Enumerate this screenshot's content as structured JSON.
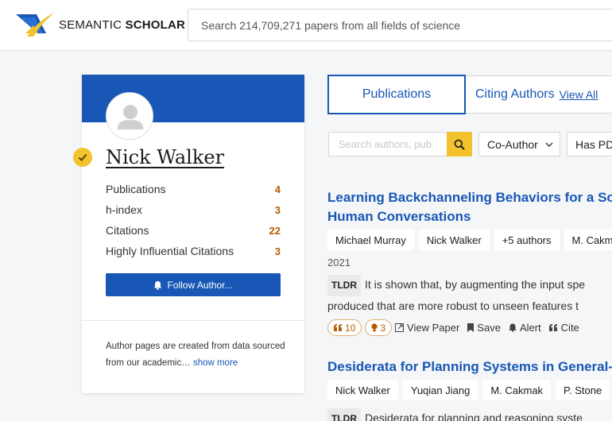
{
  "header": {
    "logo_text_light": "SEMANTIC",
    "logo_text_bold": "SCHOLAR",
    "search_placeholder": "Search 214,709,271 papers from all fields of science"
  },
  "author": {
    "name": "Nick Walker",
    "stats": [
      {
        "label": "Publications",
        "value": "4"
      },
      {
        "label": "h-index",
        "value": "3"
      },
      {
        "label": "Citations",
        "value": "22"
      },
      {
        "label": "Highly Influential Citations",
        "value": "3"
      }
    ],
    "follow_label": "Follow Author...",
    "footer_text": "Author pages are created from data sourced from our academic…",
    "show_more": "show more"
  },
  "tabs": {
    "publications": "Publications",
    "citing_authors": "Citing Authors",
    "view_all": "View All"
  },
  "filters": {
    "search_placeholder": "Search authors, pub",
    "coauthor": "Co-Author",
    "has_pdf": "Has PD"
  },
  "papers": [
    {
      "title_line1": "Learning Backchanneling Behaviors for a Soc",
      "title_line2": "Human Conversations",
      "authors": [
        "Michael Murray",
        "Nick Walker",
        "+5 authors",
        "M. Cakm"
      ],
      "year": "2021",
      "tldr_label": "TLDR",
      "tldr_line1": "It is shown that, by augmenting the input spe",
      "tldr_line2": "produced that are more robust to unseen features t",
      "citations": "10",
      "influential": "3",
      "view_paper": "View Paper",
      "save": "Save",
      "alert": "Alert",
      "cite": "Cite"
    },
    {
      "title_line1": "Desiderata for Planning Systems in General-P",
      "authors": [
        "Nick Walker",
        "Yuqian Jiang",
        "M. Cakmak",
        "P. Stone"
      ],
      "tldr_label": "TLDR",
      "tldr_line1": "Desiderata for planning and reasoning syste"
    }
  ],
  "colors": {
    "brand_blue": "#1857b6",
    "accent_yellow": "#f2c32d",
    "stat_orange": "#b35c00"
  }
}
